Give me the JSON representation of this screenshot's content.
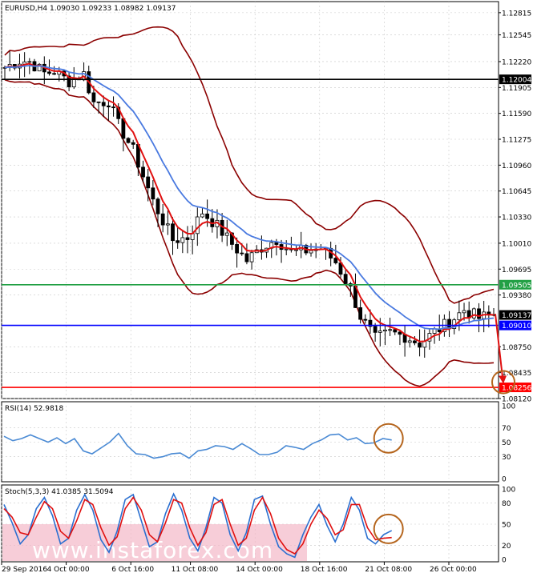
{
  "chart_data": [
    {
      "type": "candlestick",
      "title": "EURUSD,H4  1.09030 1.09233 1.08982 1.09137",
      "ylim": [
        1.0812,
        1.1295
      ],
      "y_ticks": [
        "1.12815",
        "1.12545",
        "1.12220",
        "1.11905",
        "1.11590",
        "1.11275",
        "1.10960",
        "1.10645",
        "1.10330",
        "1.10010",
        "1.09695",
        "1.09380",
        "1.08750",
        "1.08435",
        "1.08120"
      ],
      "x_ticks": [
        "29 Sep 2016",
        "4 Oct 00:00",
        "6 Oct 16:00",
        "11 Oct 08:00",
        "14 Oct 00:00",
        "18 Oct 16:00",
        "21 Oct 08:00",
        "26 Oct 00:00"
      ],
      "horizontal_levels": [
        {
          "label": "1.12004",
          "value": 1.12004,
          "color": "#000000"
        },
        {
          "label": "1.09505",
          "value": 1.09505,
          "color": "#22a045"
        },
        {
          "label": "1.09010",
          "value": 1.0901,
          "color": "#0000ff"
        },
        {
          "label": "1.08256",
          "value": 1.08256,
          "color": "#ff0000"
        }
      ],
      "current_price": {
        "label": "1.09137",
        "value": 1.09137
      },
      "close_path": [
        [
          0,
          1.1215
        ],
        [
          3,
          1.1223
        ],
        [
          5,
          1.1222
        ],
        [
          8,
          1.1208
        ],
        [
          10,
          1.121
        ],
        [
          13,
          1.1198
        ],
        [
          16,
          1.1207
        ],
        [
          18,
          1.1172
        ],
        [
          21,
          1.1174
        ],
        [
          23,
          1.1145
        ],
        [
          26,
          1.1114
        ],
        [
          30,
          1.1052
        ],
        [
          34,
          1.1005
        ],
        [
          37,
          1.1008
        ],
        [
          40,
          1.1039
        ],
        [
          43,
          1.1022
        ],
        [
          46,
          1.1
        ],
        [
          49,
          1.098
        ],
        [
          52,
          1.0996
        ],
        [
          55,
          1.1006
        ],
        [
          58,
          1.099
        ],
        [
          61,
          1.0992
        ],
        [
          64,
          1.0995
        ],
        [
          67,
          1.0978
        ],
        [
          70,
          1.0945
        ],
        [
          72,
          1.0912
        ],
        [
          75,
          1.0885
        ],
        [
          78,
          1.0892
        ],
        [
          81,
          1.0888
        ],
        [
          84,
          1.0879
        ],
        [
          87,
          1.0893
        ],
        [
          90,
          1.0905
        ],
        [
          93,
          1.092
        ],
        [
          96,
          1.091
        ],
        [
          99,
          1.0914
        ]
      ],
      "forecast_arrow": {
        "from": 1.0915,
        "to": 1.0832
      },
      "indicators": [
        "Bollinger Bands",
        "Moving averages (red, blue)"
      ]
    },
    {
      "type": "line",
      "title": "RSI(14) 52.9818",
      "ylim": [
        0,
        100
      ],
      "y_ticks": [
        "100",
        "70",
        "50",
        "30",
        "0"
      ],
      "series": [
        {
          "name": "RSI(14)",
          "color": "#4a8ad4",
          "values": [
            58,
            52,
            55,
            60,
            55,
            50,
            56,
            48,
            55,
            38,
            34,
            42,
            50,
            62,
            45,
            34,
            33,
            28,
            30,
            34,
            35,
            28,
            38,
            40,
            45,
            44,
            40,
            48,
            41,
            33,
            33,
            36,
            45,
            43,
            40,
            48,
            53,
            60,
            61,
            53,
            56,
            48,
            49,
            55,
            53
          ]
        }
      ],
      "last_value": 52.9818
    },
    {
      "type": "line",
      "title": "Stoch(5,3,3) 41.0385 31.5094",
      "ylim": [
        0,
        100
      ],
      "y_ticks": [
        "100",
        "80",
        "50",
        "20",
        "0"
      ],
      "series": [
        {
          "name": "%K",
          "color": "#2a6fd0",
          "values": [
            78,
            52,
            22,
            35,
            72,
            88,
            62,
            22,
            30,
            70,
            92,
            70,
            28,
            10,
            40,
            85,
            92,
            55,
            18,
            25,
            65,
            93,
            70,
            30,
            12,
            45,
            88,
            80,
            35,
            12,
            38,
            85,
            90,
            50,
            18,
            8,
            3,
            35,
            60,
            78,
            48,
            25,
            50,
            88,
            70,
            30,
            22,
            35,
            41
          ]
        },
        {
          "name": "%D",
          "color": "#e01010",
          "values": [
            72,
            60,
            38,
            35,
            60,
            82,
            72,
            40,
            30,
            55,
            85,
            78,
            45,
            20,
            32,
            72,
            88,
            70,
            35,
            25,
            52,
            85,
            80,
            45,
            20,
            38,
            78,
            85,
            50,
            20,
            30,
            70,
            88,
            65,
            30,
            14,
            8,
            22,
            50,
            70,
            58,
            35,
            42,
            78,
            78,
            45,
            28,
            30,
            31
          ]
        }
      ],
      "last_values": [
        "41.0385",
        "31.5094"
      ]
    }
  ],
  "watermark": "www.instaforex.com"
}
